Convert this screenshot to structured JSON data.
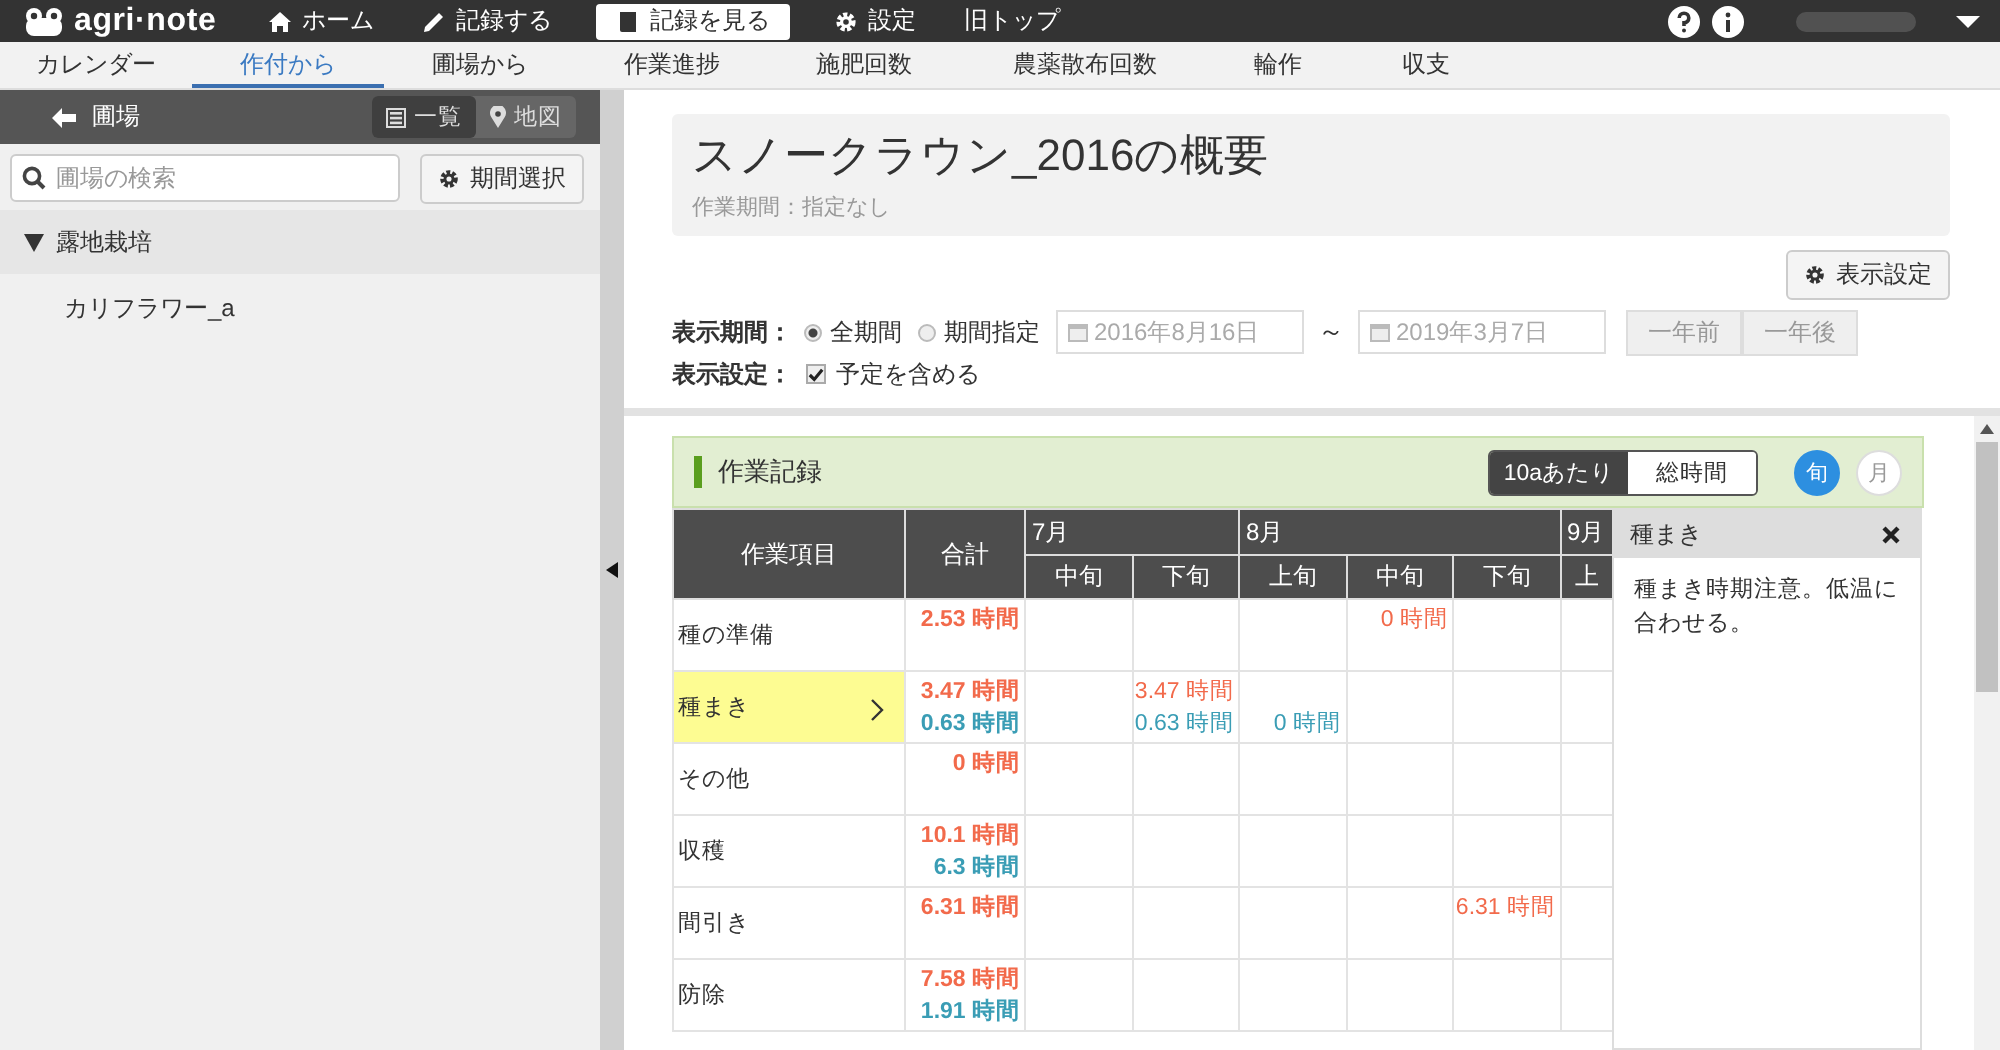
{
  "header": {
    "logo": "agri·note",
    "nav": [
      {
        "label": "ホーム",
        "selected": false
      },
      {
        "label": "記録する",
        "selected": false
      },
      {
        "label": "記録を見る",
        "selected": true
      },
      {
        "label": "設定",
        "selected": false
      },
      {
        "label": "旧トップ",
        "selected": false
      }
    ]
  },
  "tabs": [
    {
      "label": "カレンダー",
      "selected": false
    },
    {
      "label": "作付から",
      "selected": true
    },
    {
      "label": "圃場から",
      "selected": false
    },
    {
      "label": "作業進捗",
      "selected": false
    },
    {
      "label": "施肥回数",
      "selected": false
    },
    {
      "label": "農薬散布回数",
      "selected": false
    },
    {
      "label": "輪作",
      "selected": false
    },
    {
      "label": "収支",
      "selected": false
    }
  ],
  "sidebar": {
    "title": "圃場",
    "views": [
      {
        "label": "一覧",
        "selected": true
      },
      {
        "label": "地図",
        "selected": false
      }
    ],
    "search": {
      "placeholder": "圃場の検索"
    },
    "period_button": "期間選択",
    "groups": [
      {
        "label": "露地栽培",
        "expanded": true,
        "children": [
          {
            "label": "カリフラワー_a"
          }
        ]
      }
    ]
  },
  "summary": {
    "title": "スノークラウン_2016の概要",
    "subtitle": "作業期間：指定なし",
    "settings_button": "表示設定",
    "period_label": "表示期間：",
    "period_options": [
      {
        "label": "全期間",
        "selected": true
      },
      {
        "label": "期間指定",
        "selected": false
      }
    ],
    "date_from": "2016年8月16日",
    "separator": "～",
    "date_to": "2019年3月7日",
    "prev_year": "一年前",
    "next_year": "一年後",
    "display_label": "表示設定：",
    "include_plans": {
      "label": "予定を含める",
      "checked": true
    }
  },
  "records": {
    "title": "作業記録",
    "units": [
      {
        "label": "10aあたり",
        "selected": true
      },
      {
        "label": "総時間",
        "selected": false
      }
    ],
    "spans": [
      {
        "label": "旬",
        "selected": true
      },
      {
        "label": "月",
        "selected": false
      }
    ],
    "table": {
      "item_header": "作業項目",
      "total_header": "合計",
      "months": [
        {
          "label": "7月",
          "periods": [
            "中旬",
            "下旬"
          ]
        },
        {
          "label": "8月",
          "periods": [
            "上旬",
            "中旬",
            "下旬"
          ]
        },
        {
          "label": "9月",
          "periods": [
            "上"
          ]
        }
      ],
      "rows": [
        {
          "item": "種の準備",
          "selected": false,
          "total": {
            "upper": "2.53 時間"
          },
          "cells": [
            {},
            {},
            {},
            {
              "upper": "0 時間"
            },
            {},
            {}
          ]
        },
        {
          "item": "種まき",
          "selected": true,
          "total": {
            "upper": "3.47 時間",
            "lower": "0.63 時間"
          },
          "cells": [
            {},
            {
              "upper": "3.47 時間",
              "lower": "0.63 時間"
            },
            {
              "lower": "0 時間"
            },
            {},
            {},
            {}
          ]
        },
        {
          "item": "その他",
          "selected": false,
          "total": {
            "upper": "0 時間"
          },
          "cells": [
            {},
            {},
            {},
            {},
            {},
            {}
          ]
        },
        {
          "item": "収穫",
          "selected": false,
          "total": {
            "upper": "10.1 時間",
            "lower": "6.3 時間"
          },
          "cells": [
            {},
            {},
            {},
            {},
            {},
            {}
          ]
        },
        {
          "item": "間引き",
          "selected": false,
          "total": {
            "upper": "6.31 時間"
          },
          "cells": [
            {},
            {},
            {},
            {},
            {
              "upper": "6.31 時間"
            },
            {}
          ]
        },
        {
          "item": "防除",
          "selected": false,
          "total": {
            "upper": "7.58 時間",
            "lower": "1.91 時間"
          },
          "cells": [
            {},
            {},
            {},
            {},
            {},
            {}
          ]
        }
      ]
    },
    "note": {
      "title": "種まき",
      "text": "種まき時期注意。低温に合わせる。"
    }
  }
}
